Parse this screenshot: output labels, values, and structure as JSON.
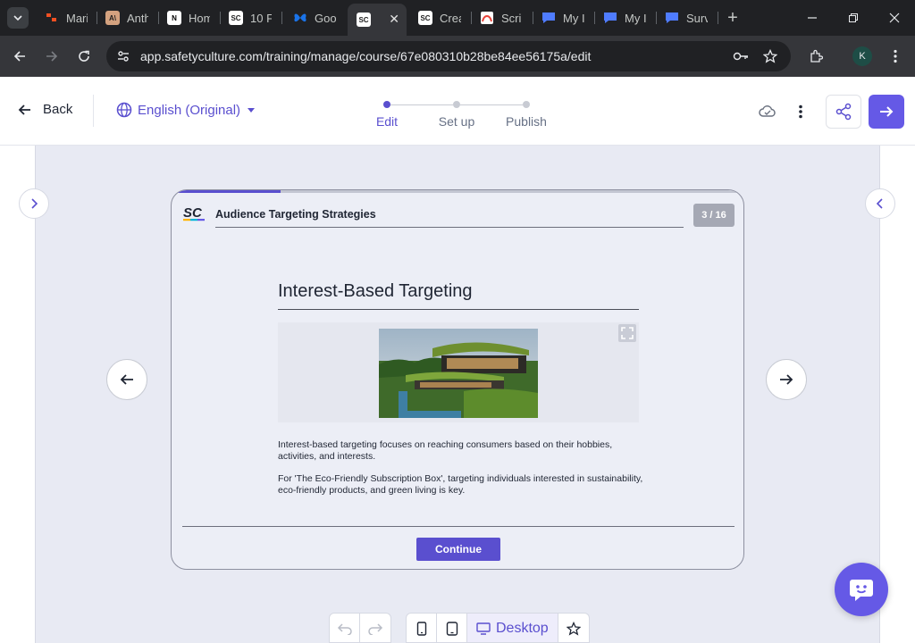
{
  "browser": {
    "tabs": [
      {
        "title": "Mari",
        "icon": "orange-app-icon",
        "color": "#f25022"
      },
      {
        "title": "Anth",
        "icon": "anthropic-icon",
        "color": "#d4a27f"
      },
      {
        "title": "Hom",
        "icon": "notion-icon",
        "color": "#ffffff"
      },
      {
        "title": "10 F",
        "icon": "safetyculture-icon",
        "color": "#ffffff"
      },
      {
        "title": "Goo",
        "icon": "butterfly-icon",
        "color": "#1a73e8"
      },
      {
        "title": "",
        "icon": "safetyculture-icon",
        "color": "#ffffff"
      },
      {
        "title": "Crea",
        "icon": "safetyculture-icon",
        "color": "#ffffff"
      },
      {
        "title": "Scri",
        "icon": "scribe-icon",
        "color": "#e8453c"
      },
      {
        "title": "My I",
        "icon": "chat-icon",
        "color": "#4f7cff"
      },
      {
        "title": "My I",
        "icon": "chat-icon",
        "color": "#4f7cff"
      },
      {
        "title": "Surv",
        "icon": "chat-icon",
        "color": "#4f7cff"
      }
    ],
    "url": "app.safetyculture.com/training/manage/course/67e080310b28be84ee56175a/edit",
    "profile_initial": "K"
  },
  "header": {
    "back_label": "Back",
    "language": "English (Original)",
    "steps": [
      "Edit",
      "Set up",
      "Publish"
    ],
    "active_step": 0,
    "accent": "#5a4fcf"
  },
  "slide": {
    "logo_text": "SC",
    "course_title": "Audience Targeting Strategies",
    "page_indicator": "3 / 16",
    "progress": 0.19,
    "lesson_title": "Interest-Based Targeting",
    "paragraph_1": "Interest-based targeting focuses on reaching consumers based on their hobbies, activities, and interests.",
    "paragraph_2": "For 'The Eco-Friendly Subscription Box', targeting individuals interested in sustainability, eco-friendly products, and green living is key.",
    "continue_label": "Continue"
  },
  "device_bar": {
    "desktop_label": "Desktop"
  }
}
